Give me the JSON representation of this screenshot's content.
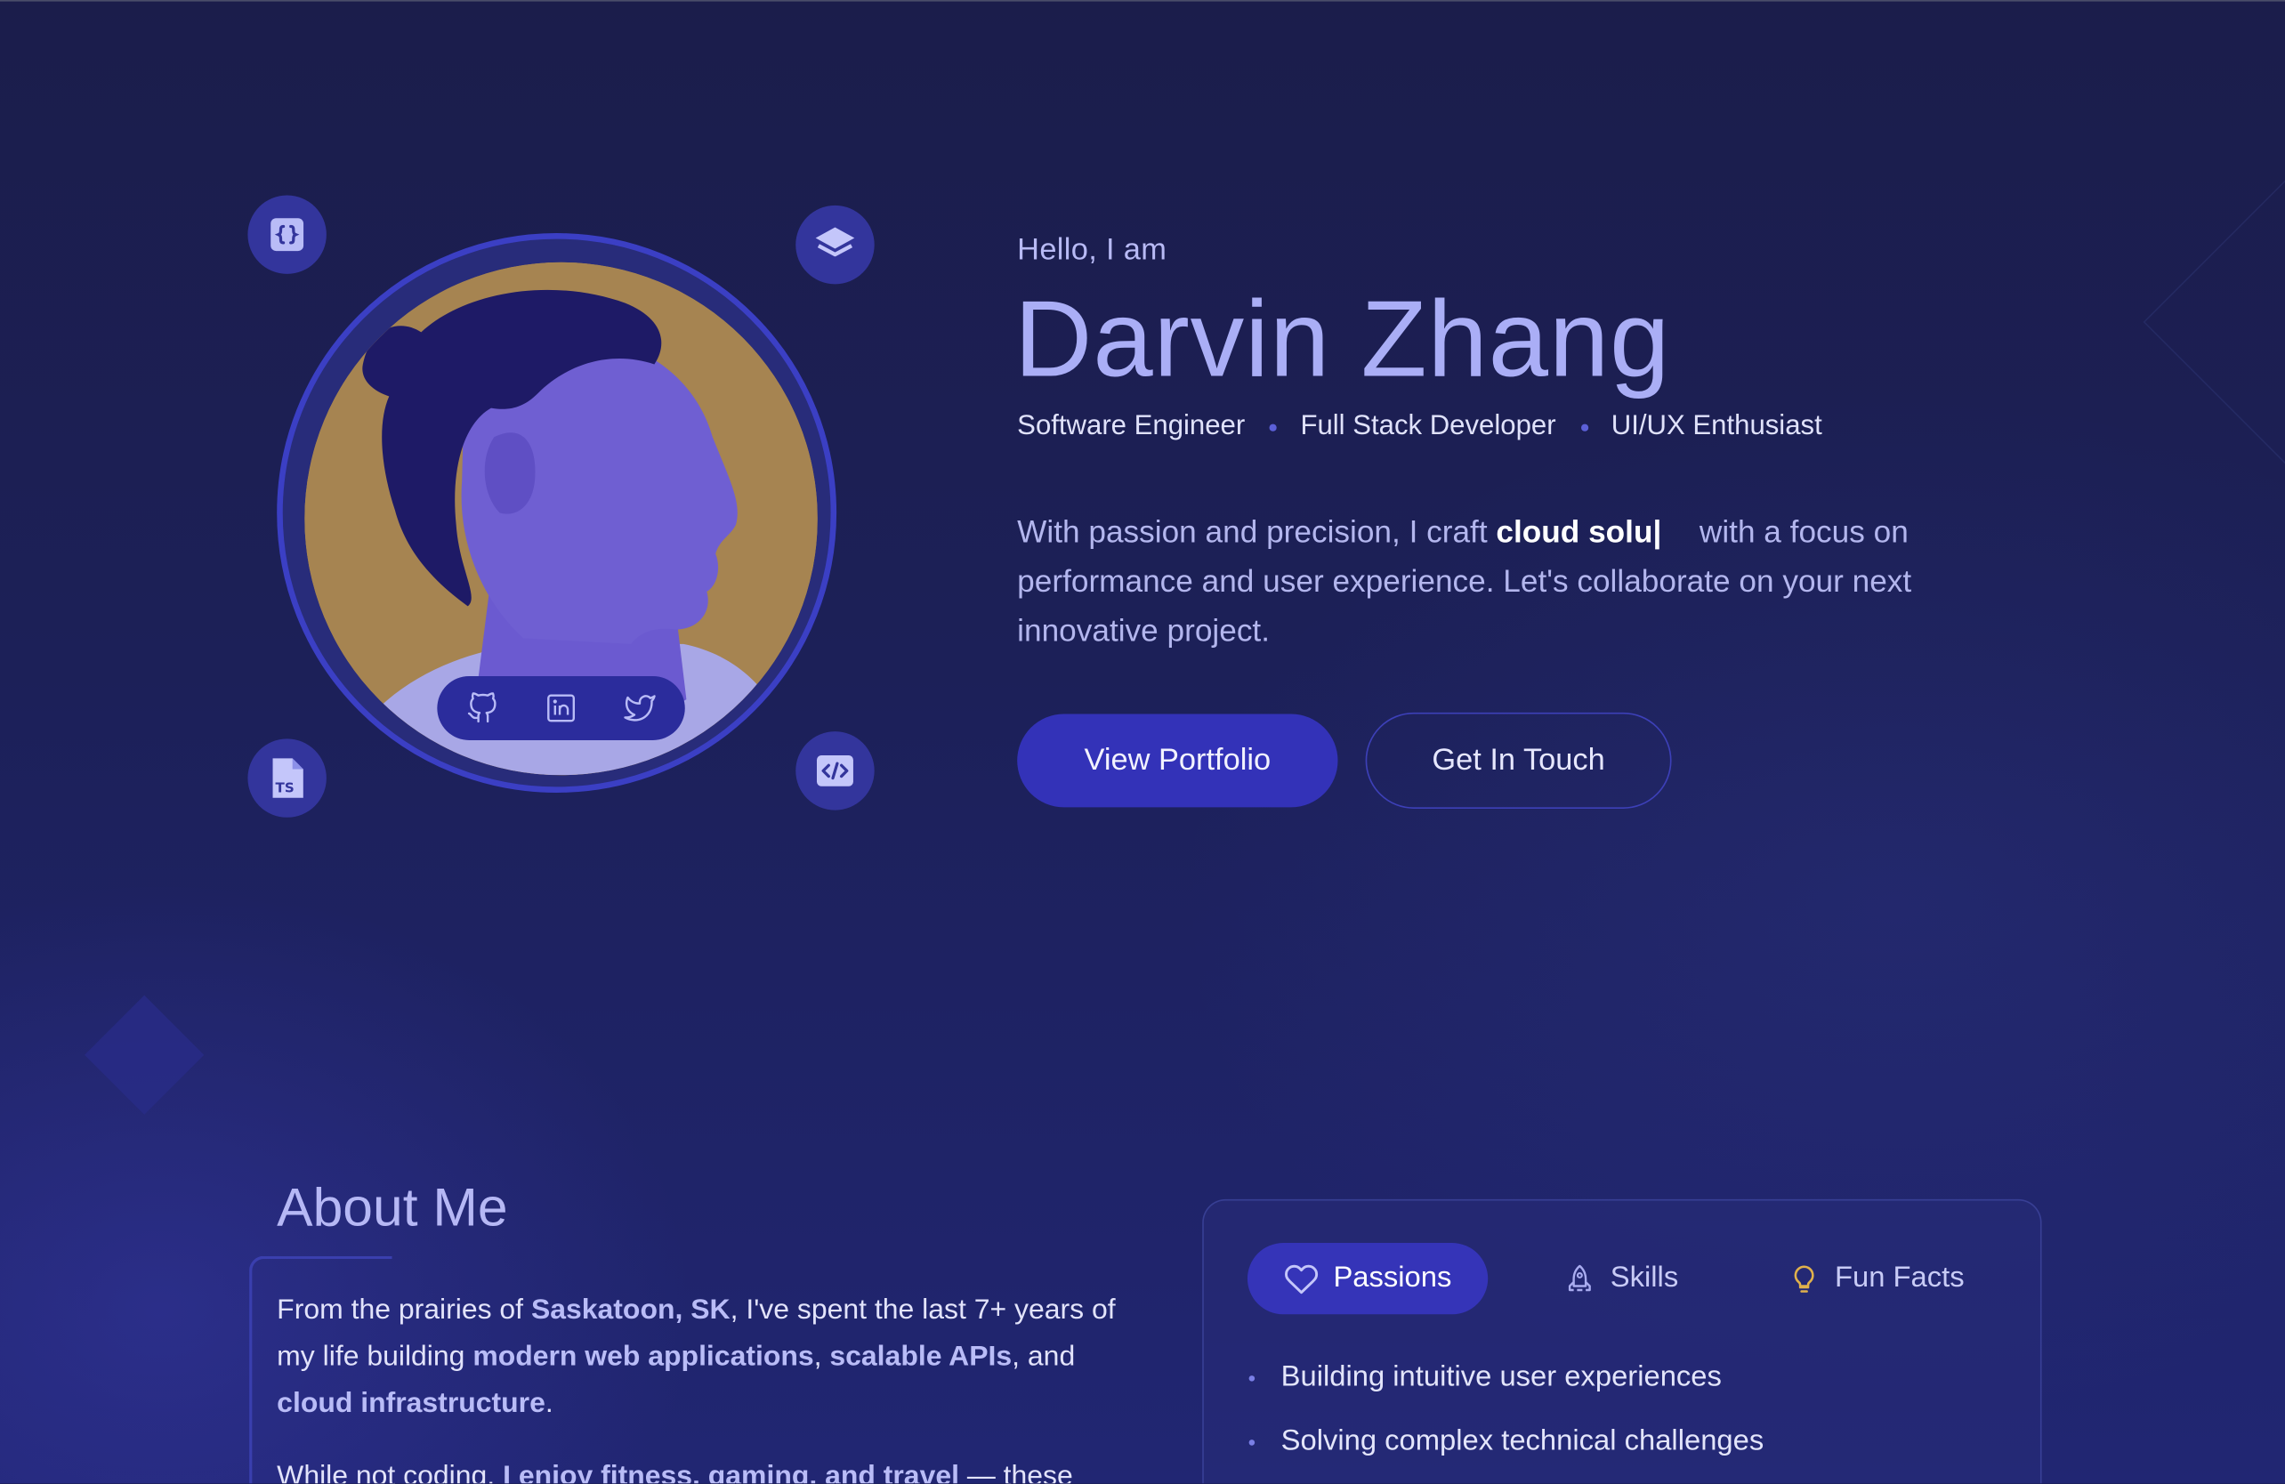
{
  "hero": {
    "greeting": "Hello, I am",
    "name": "Darvin Zhang",
    "roles": [
      "Software Engineer",
      "Full Stack Developer",
      "UI/UX Enthusiast"
    ],
    "bio_prefix": "With passion and precision, I craft ",
    "bio_highlight": "cloud solu|",
    "bio_suffix": "with a focus on performance and user experience. Let's collaborate on your next innovative project.",
    "primary_button": "View Portfolio",
    "secondary_button": "Get In Touch"
  },
  "avatar": {
    "badges": [
      "braces-icon",
      "layers-icon",
      "typescript-file-icon",
      "code-icon"
    ],
    "social": [
      "github-icon",
      "linkedin-icon",
      "twitter-icon"
    ]
  },
  "about": {
    "title": "About Me",
    "p1_a": "From the prairies of ",
    "p1_city": "Saskatoon, SK",
    "p1_b": ", I've spent the last 7+ years of my life building ",
    "p1_web": "modern web applications",
    "p1_c": ", ",
    "p1_apis": "scalable APIs",
    "p1_d": ", and ",
    "p1_cloud": "cloud infrastructure",
    "p1_e": ".",
    "p2_a": "While not coding, ",
    "p2_hl": "I enjoy fitness, gaming, and travel",
    "p2_b": " — these"
  },
  "card": {
    "tabs": [
      {
        "label": "Passions",
        "icon": "heart-icon"
      },
      {
        "label": "Skills",
        "icon": "rocket-icon"
      },
      {
        "label": "Fun Facts",
        "icon": "lightbulb-icon"
      }
    ],
    "items": [
      "Building intuitive user experiences",
      "Solving complex technical challenges"
    ]
  },
  "colors": {
    "background": "#1c1f55",
    "accent": "#3534b8",
    "name_text": "#aaaef6",
    "photo_bg": "#a68451"
  }
}
